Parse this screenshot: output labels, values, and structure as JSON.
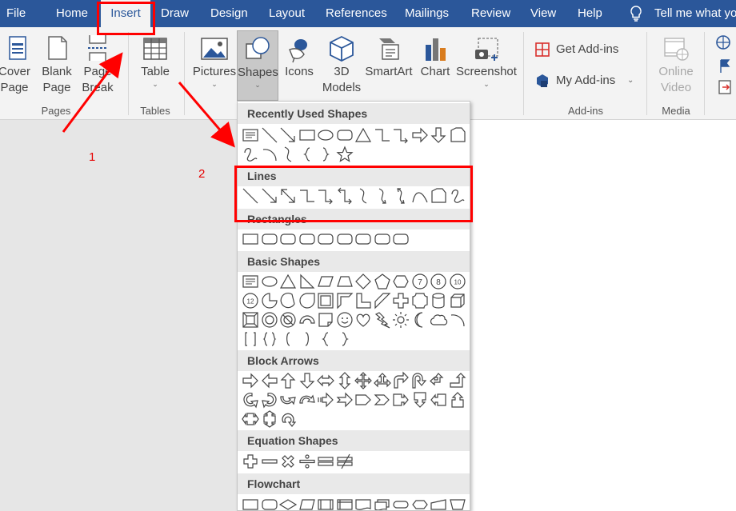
{
  "tabs": [
    "File",
    "Home",
    "Insert",
    "Draw",
    "Design",
    "Layout",
    "References",
    "Mailings",
    "Review",
    "View",
    "Help"
  ],
  "active_tab": "Insert",
  "tell_me": "Tell me what yo",
  "ribbon": {
    "cover_page": {
      "line1": "Cover",
      "line2": "Page"
    },
    "blank_page": {
      "line1": "Blank",
      "line2": "Page"
    },
    "page_break": {
      "line1": "Page",
      "line2": "Break"
    },
    "table": "Table",
    "pictures": "Pictures",
    "shapes": "Shapes",
    "icons": "Icons",
    "models": {
      "line1": "3D",
      "line2": "Models"
    },
    "smartart": "SmartArt",
    "chart": "Chart",
    "screenshot": "Screenshot",
    "get_addins": "Get Add-ins",
    "my_addins": "My Add-ins",
    "online_video": {
      "line1": "Online",
      "line2": "Video"
    },
    "groups": {
      "pages": "Pages",
      "tables": "Tables",
      "addins": "Add-ins",
      "media": "Media"
    }
  },
  "gallery": {
    "sections": {
      "recent": "Recently Used Shapes",
      "lines": "Lines",
      "rectangles": "Rectangles",
      "basic": "Basic Shapes",
      "block_arrows": "Block Arrows",
      "equation": "Equation Shapes",
      "flowchart": "Flowchart"
    }
  },
  "annotations": {
    "step1": "1",
    "step2": "2"
  },
  "colors": {
    "ribbon_blue": "#2b579a",
    "annotation_red": "#ff0000"
  }
}
